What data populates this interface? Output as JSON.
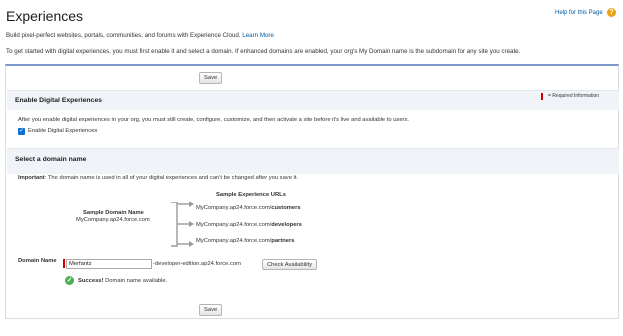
{
  "header": {
    "title": "Experiences",
    "help_link": "Help for this Page",
    "help_icon": "help-icon",
    "subtitle": "Build pixel-perfect websites, portals, communities, and forums with Experience Cloud.",
    "learn_more": "Learn More",
    "intro": "To get started with digital experiences, you must first enable it and select a domain. If enhanced domains are enabled, your org's My Domain name is the subdomain for any site you create."
  },
  "toolbar": {
    "save_label": "Save"
  },
  "enable_section": {
    "title": "Enable Digital Experiences",
    "required_info": "= Required Information",
    "description": "After you enable digital experiences in your org, you must still create, configure, customize, and then activate a site before it's live and available to users.",
    "checkbox_label": "Enable Digital Experiences",
    "checkbox_checked": true
  },
  "domain_section": {
    "title": "Select a domain name",
    "important_label": "Important",
    "important_text": ": The domain name is used in all of your digital experiences and can't be changed after you save it.",
    "sample_domain_heading": "Sample Domain Name",
    "sample_domain_value": "MyCompany.ap24.force.com",
    "sample_urls_heading": "Sample Experience URLs",
    "sample_urls": [
      {
        "prefix": "MyCompany.ap24.force.com/",
        "path": "customers"
      },
      {
        "prefix": "MyCompany.ap24.force.com/",
        "path": "developers"
      },
      {
        "prefix": "MyCompany.ap24.force.com/",
        "path": "partners"
      }
    ],
    "domain_name_label": "Domain Name",
    "domain_name_value": "Merfantz",
    "domain_suffix": "-developer-edition.ap24.force.com",
    "check_availability_label": "Check Availability",
    "success_label": "Success!",
    "success_text": " Domain name available."
  },
  "colors": {
    "link": "#015ba7",
    "section_bg": "#f0f3f7",
    "panel_top_border": "#7c97c8",
    "required": "#cc0000",
    "success": "#4caf50"
  }
}
